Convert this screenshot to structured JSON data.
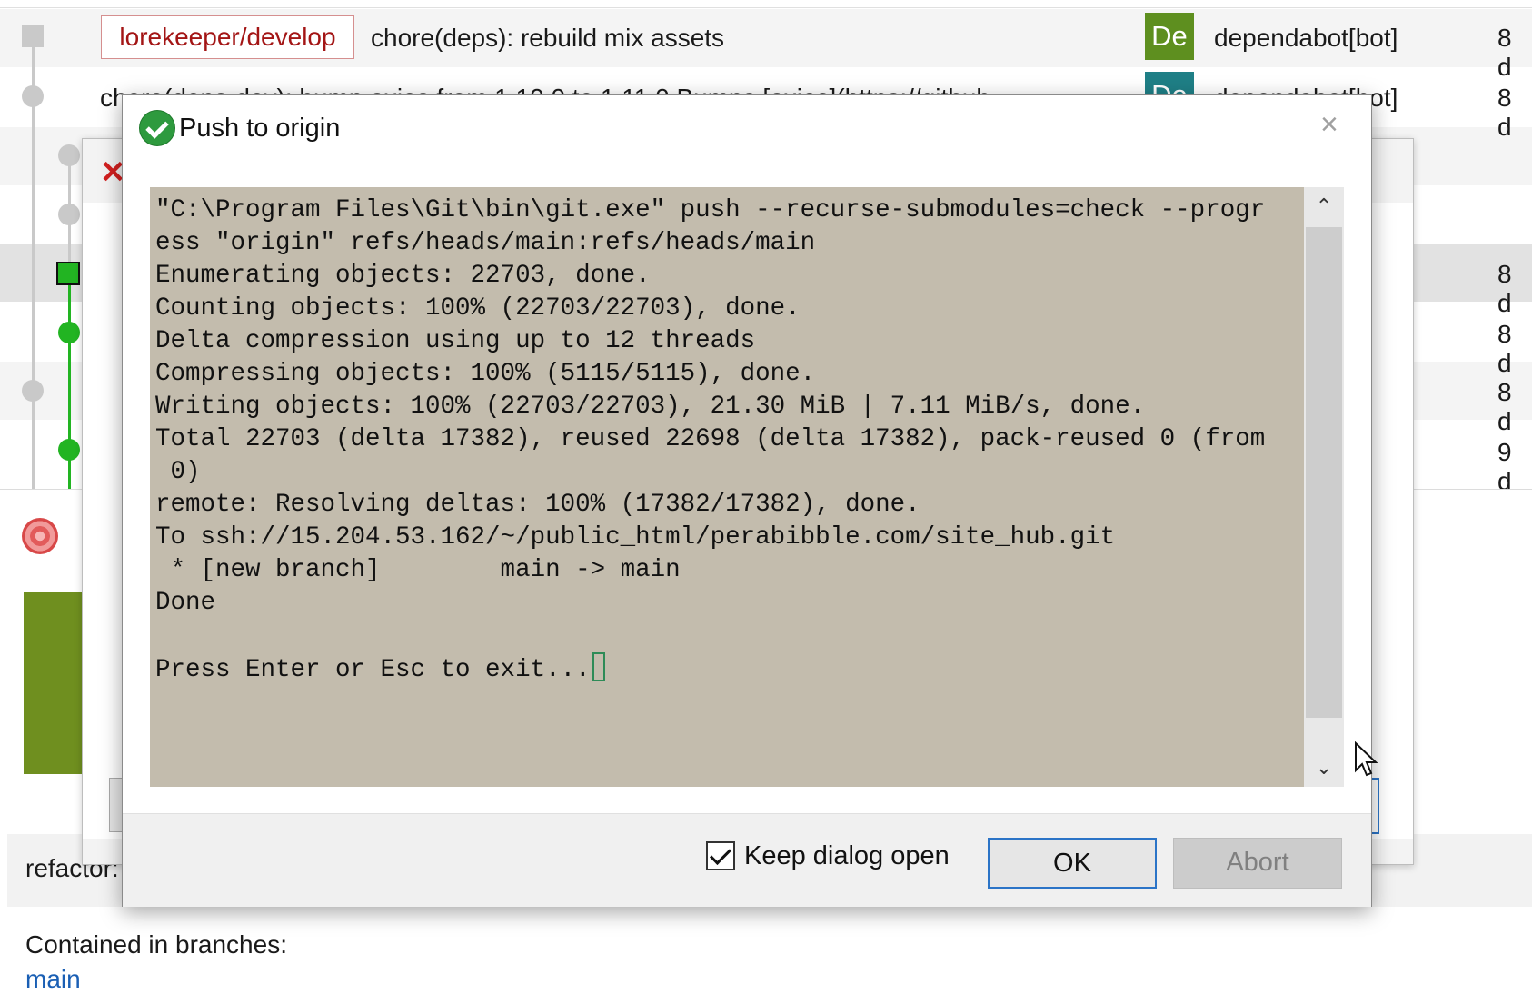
{
  "log": {
    "rows": [
      {
        "branch_tag": "lorekeeper/develop",
        "message": "chore(deps): rebuild mix assets",
        "avatar": "De",
        "avatar_color": "#5e8f1f",
        "author": "dependabot[bot]",
        "date": "8 d"
      },
      {
        "message": "chore(deps-dev): bump axios from 1.10.0 to 1.11.0 Bumps [axios](https://github",
        "avatar": "De",
        "avatar_color": "#1f7f86",
        "author": "dependabot[bot]",
        "date": "8 d"
      }
    ],
    "dates": [
      "8 d",
      "8 d",
      "8 d",
      "9 d"
    ]
  },
  "details": {
    "refactor_text": "refactor:",
    "contained_label": "Contained in branches:",
    "branch_link": "main"
  },
  "dialog": {
    "title": "Push to origin",
    "close_glyph": "×",
    "console_lines": [
      "\"C:\\Program Files\\Git\\bin\\git.exe\" push --recurse-submodules=check --progr",
      "ess \"origin\" refs/heads/main:refs/heads/main",
      "Enumerating objects: 22703, done.",
      "Counting objects: 100% (22703/22703), done.",
      "Delta compression using up to 12 threads",
      "Compressing objects: 100% (5115/5115), done.",
      "Writing objects: 100% (22703/22703), 21.30 MiB | 7.11 MiB/s, done.",
      "Total 22703 (delta 17382), reused 22698 (delta 17382), pack-reused 0 (from",
      " 0)",
      "remote: Resolving deltas: 100% (17382/17382), done.",
      "To ssh://15.204.53.162/~/public_html/perabibble.com/site_hub.git",
      " * [new branch]        main -> main",
      "Done",
      "",
      "Press Enter or Esc to exit..."
    ],
    "keep_open_label": "Keep dialog open",
    "keep_open_checked": true,
    "ok_label": "OK",
    "abort_label": "Abort",
    "scroll_up_glyph": "⌃",
    "scroll_down_glyph": "⌄"
  },
  "colors": {
    "graph_gray": "#c9c9c9",
    "graph_green": "#22b422",
    "console_bg": "#c3bcad",
    "accent_blue": "#2b74c7"
  }
}
